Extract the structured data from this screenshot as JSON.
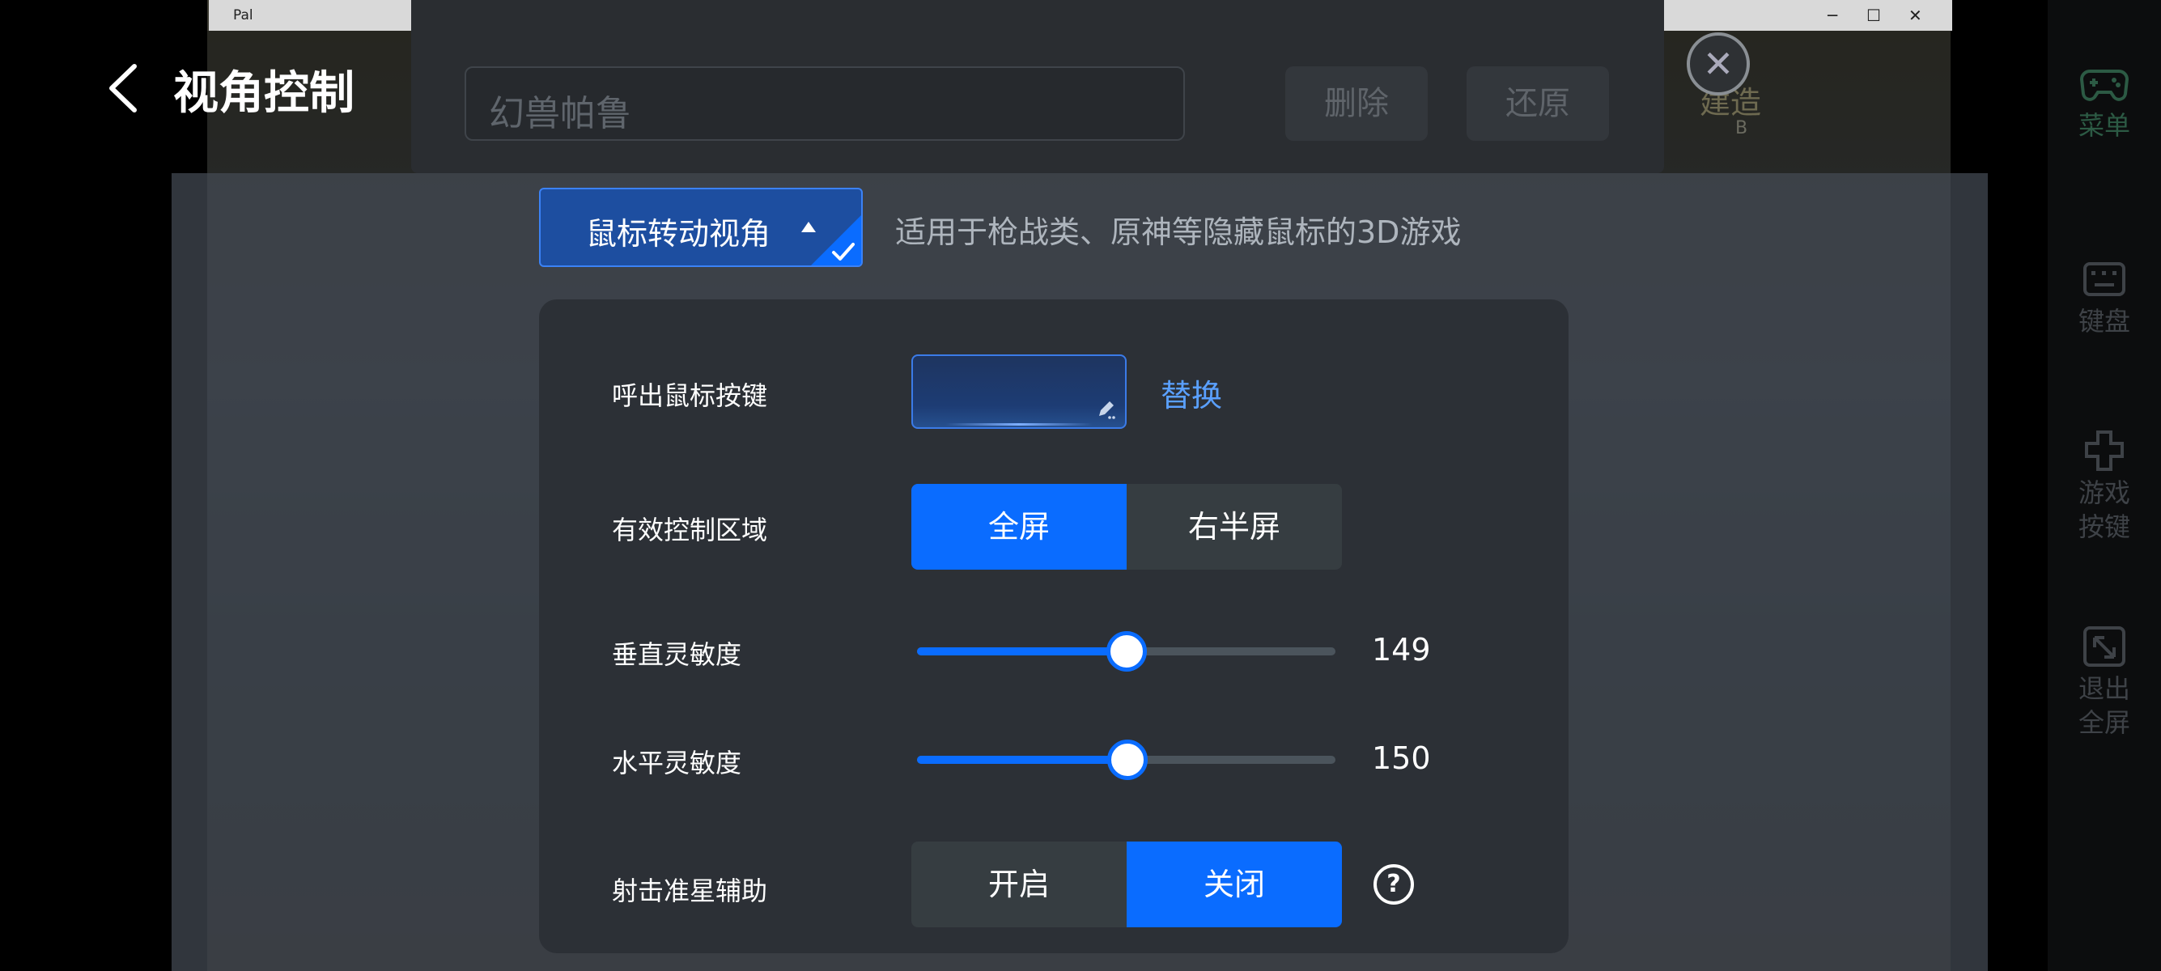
{
  "window": {
    "title": "Pal",
    "min_glyph": "─",
    "max_glyph": "☐",
    "close_glyph": "✕"
  },
  "background": {
    "game_name": "幻兽帕鲁",
    "delete_label": "删除",
    "restore_label": "还原",
    "close_glyph": "✕",
    "build_label": "建造",
    "build_key": "B"
  },
  "sidebar": {
    "items": [
      {
        "label": "菜单",
        "icon": "gamepad-icon"
      },
      {
        "label": "键盘",
        "icon": "keyboard-icon"
      },
      {
        "label": "游戏按键",
        "icon": "dpad-icon"
      },
      {
        "label": "退出全屏",
        "icon": "exit-fullscreen-icon"
      }
    ]
  },
  "header": {
    "title": "视角控制"
  },
  "mode": {
    "selected": "鼠标转动视角",
    "description": "适用于枪战类、原神等隐藏鼠标的3D游戏"
  },
  "settings": {
    "hotkey": {
      "label": "呼出鼠标按键",
      "value": "",
      "replace_label": "替换"
    },
    "area": {
      "label": "有效控制区域",
      "options": [
        "全屏",
        "右半屏"
      ],
      "selected": "全屏"
    },
    "vertical": {
      "label": "垂直灵敏度",
      "value": 149,
      "fraction": 0.5
    },
    "horizontal": {
      "label": "水平灵敏度",
      "value": 150,
      "fraction": 0.502
    },
    "aim_assist": {
      "label": "射击准星辅助",
      "options": [
        "开启",
        "关闭"
      ],
      "selected": "关闭"
    }
  },
  "colors": {
    "accent": "#0a6cff",
    "link": "#5aa0ff",
    "card": "#2c3036"
  }
}
